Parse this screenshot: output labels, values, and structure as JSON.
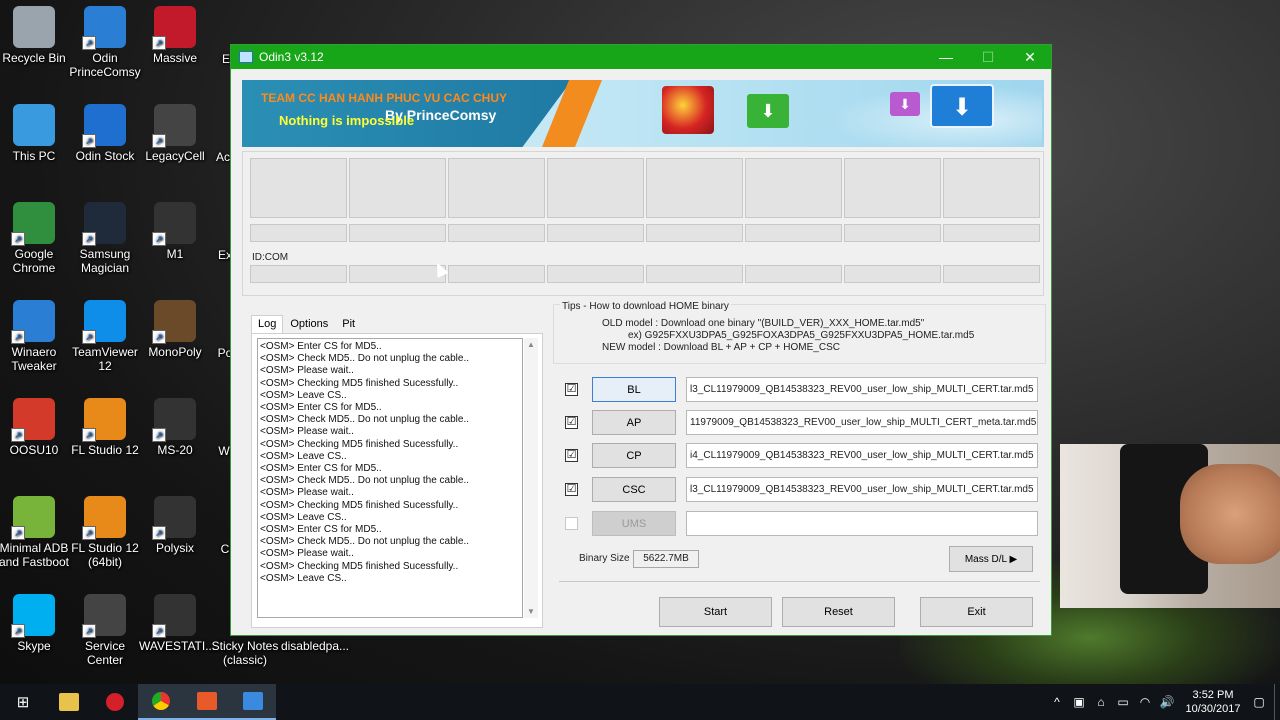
{
  "desktop": {
    "icons": [
      {
        "label": "Recycle Bin",
        "icon": "recycle-bin-icon",
        "color": "#9aa4ad"
      },
      {
        "label": "Odin PrinceComsy",
        "icon": "odin-icon",
        "color": "#2a7fd4"
      },
      {
        "label": "Massive",
        "icon": "massive-icon",
        "color": "#c21a2a"
      },
      {
        "label": "This PC",
        "icon": "pc-icon",
        "color": "#3a9ae0"
      },
      {
        "label": "Odin Stock",
        "icon": "odin-android-icon",
        "color": "#1f6fd0"
      },
      {
        "label": "LegacyCell",
        "icon": "legacycell-icon",
        "color": "#444444"
      },
      {
        "label": "Google Chrome",
        "icon": "chrome-icon",
        "color": "#2f8f3f"
      },
      {
        "label": "Samsung Magician",
        "icon": "samsung-magician-icon",
        "color": "#1f2a3a"
      },
      {
        "label": "M1",
        "icon": "m1-icon",
        "color": "#333333"
      },
      {
        "label": "Winaero Tweaker",
        "icon": "winaero-icon",
        "color": "#2a7fd4"
      },
      {
        "label": "TeamViewer 12",
        "icon": "teamviewer-icon",
        "color": "#0e8ee9"
      },
      {
        "label": "MonoPoly",
        "icon": "monopoly-icon",
        "color": "#6b4a2a"
      },
      {
        "label": "OOSU10",
        "icon": "oosu10-icon",
        "color": "#d43a2a"
      },
      {
        "label": "FL Studio 12",
        "icon": "fl-studio-icon",
        "color": "#e88a1a"
      },
      {
        "label": "MS-20",
        "icon": "ms20-icon",
        "color": "#333333"
      },
      {
        "label": "Minimal ADB and Fastboot",
        "icon": "android-icon",
        "color": "#78b43a"
      },
      {
        "label": "FL Studio 12 (64bit)",
        "icon": "fl-studio-64-icon",
        "color": "#e88a1a"
      },
      {
        "label": "Polysix",
        "icon": "polysix-icon",
        "color": "#333333"
      },
      {
        "label": "Skype",
        "icon": "skype-icon",
        "color": "#00aff0"
      },
      {
        "label": "Service Center",
        "icon": "service-center-icon",
        "color": "#444444"
      },
      {
        "label": "WAVESTATI...",
        "icon": "wavestation-icon",
        "color": "#333333"
      },
      {
        "label": "Sticky Notes (classic)",
        "icon": "sticky-notes-icon",
        "color": "#e8d84a"
      },
      {
        "label": "disabledpa...",
        "icon": "file-icon",
        "color": "#2a2a2a"
      }
    ],
    "partial_labels": [
      "E",
      "Ac",
      "Ex",
      "Po",
      "W",
      "C"
    ]
  },
  "window": {
    "title": "Odin3 v3.12",
    "minimize": "—",
    "maximize": "☐",
    "close": "✕",
    "titlebar_color": "#17a617"
  },
  "banner": {
    "team": "TEAM CC HAN HANH PHUC VU CAC CHUY",
    "slogan": "Nothing is impossible",
    "by": "By PrinceComsy"
  },
  "device": {
    "idcom_label": "ID:COM"
  },
  "log": {
    "tabs": [
      "Log",
      "Options",
      "Pit"
    ],
    "lines": [
      "<OSM> Enter CS for MD5..",
      "<OSM> Check MD5.. Do not unplug the cable..",
      "<OSM> Please wait..",
      "<OSM> Checking MD5 finished Sucessfully..",
      "<OSM> Leave CS..",
      "<OSM> Enter CS for MD5..",
      "<OSM> Check MD5.. Do not unplug the cable..",
      "<OSM> Please wait..",
      "<OSM> Checking MD5 finished Sucessfully..",
      "<OSM> Leave CS..",
      "<OSM> Enter CS for MD5..",
      "<OSM> Check MD5.. Do not unplug the cable..",
      "<OSM> Please wait..",
      "<OSM> Checking MD5 finished Sucessfully..",
      "<OSM> Leave CS..",
      "<OSM> Enter CS for MD5..",
      "<OSM> Check MD5.. Do not unplug the cable..",
      "<OSM> Please wait..",
      "<OSM> Checking MD5 finished Sucessfully..",
      "<OSM> Leave CS.."
    ]
  },
  "tips": {
    "title": "Tips - How to download HOME binary",
    "line1": "OLD model  : Download one binary    \"(BUILD_VER)_XXX_HOME.tar.md5\"",
    "line2": "ex) G925FXXU3DPA5_G925FOXA3DPA5_G925FXXU3DPA5_HOME.tar.md5",
    "line3": "NEW model : Download BL + AP + CP + HOME_CSC"
  },
  "files": [
    {
      "label": "BL",
      "checked": "☑",
      "path": "l3_CL11979009_QB14538323_REV00_user_low_ship_MULTI_CERT.tar.md5"
    },
    {
      "label": "AP",
      "checked": "☑",
      "path": "11979009_QB14538323_REV00_user_low_ship_MULTI_CERT_meta.tar.md5"
    },
    {
      "label": "CP",
      "checked": "☑",
      "path": "i4_CL11979009_QB14538323_REV00_user_low_ship_MULTI_CERT.tar.md5"
    },
    {
      "label": "CSC",
      "checked": "☑",
      "path": "l3_CL11979009_QB14538323_REV00_user_low_ship_MULTI_CERT.tar.md5"
    },
    {
      "label": "UMS",
      "checked": "",
      "path": ""
    }
  ],
  "binary": {
    "label": "Binary Size",
    "value": "5622.7MB"
  },
  "buttons": {
    "mass_dl": "Mass D/L ▶",
    "start": "Start",
    "reset": "Reset",
    "exit": "Exit"
  },
  "taskbar": {
    "start_glyph": "⊞",
    "clock_time": "3:52 PM",
    "clock_date": "10/30/2017",
    "tray": [
      "^",
      "▣",
      "⌂",
      "▭",
      "◠",
      "🔊"
    ]
  }
}
